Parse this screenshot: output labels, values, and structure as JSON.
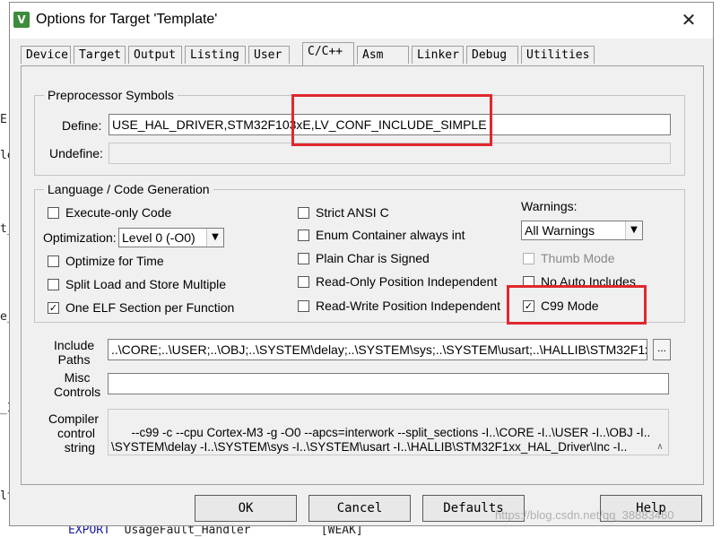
{
  "window": {
    "title": "Options for Target 'Template'",
    "app_icon_glyph": "V"
  },
  "tabs": [
    {
      "label": "Device"
    },
    {
      "label": "Target"
    },
    {
      "label": "Output"
    },
    {
      "label": "Listing"
    },
    {
      "label": "User"
    },
    {
      "label": "C/C++"
    },
    {
      "label": "Asm"
    },
    {
      "label": "Linker"
    },
    {
      "label": "Debug"
    },
    {
      "label": "Utilities"
    }
  ],
  "preprocessor": {
    "group_label": "Preprocessor Symbols",
    "define_label": "Define:",
    "define_value": "USE_HAL_DRIVER,STM32F103xE,LV_CONF_INCLUDE_SIMPLE",
    "undefine_label": "Undefine:",
    "undefine_value": ""
  },
  "language": {
    "group_label": "Language / Code Generation",
    "execute_only": {
      "label": "Execute-only Code",
      "checked": false
    },
    "optimization_label": "Optimization:",
    "optimization_value": "Level 0 (-O0)",
    "optimize_time": {
      "label": "Optimize for Time",
      "checked": false
    },
    "split_load": {
      "label": "Split Load and Store Multiple",
      "checked": false
    },
    "one_elf": {
      "label": "One ELF Section per Function",
      "checked": true
    },
    "strict_ansi": {
      "label": "Strict ANSI C",
      "checked": false
    },
    "enum_container": {
      "label": "Enum Container always int",
      "checked": false
    },
    "plain_char": {
      "label": "Plain Char is Signed",
      "checked": false
    },
    "ro_pi": {
      "label": "Read-Only Position Independent",
      "checked": false
    },
    "rw_pi": {
      "label": "Read-Write Position Independent",
      "checked": false
    },
    "warnings_label": "Warnings:",
    "warnings_value": "All Warnings",
    "thumb_mode": {
      "label": "Thumb Mode",
      "checked": false
    },
    "no_auto_includes": {
      "label": "No Auto Includes",
      "checked": false
    },
    "c99_mode": {
      "label": "C99 Mode",
      "checked": true
    }
  },
  "paths": {
    "include_label_1": "Include",
    "include_label_2": "Paths",
    "include_value": "..\\CORE;..\\USER;..\\OBJ;..\\SYSTEM\\delay;..\\SYSTEM\\sys;..\\SYSTEM\\usart;..\\HALLIB\\STM32F1x",
    "browse_label": "...",
    "misc_label_1": "Misc",
    "misc_label_2": "Controls",
    "misc_value": "",
    "compiler_label_1": "Compiler",
    "compiler_label_2": "control",
    "compiler_label_3": "string",
    "compiler_value": "--c99 -c --cpu Cortex-M3 -g -O0 --apcs=interwork --split_sections -I..\\CORE -I..\\USER -I..\\OBJ -I..\n\\SYSTEM\\delay -I..\\SYSTEM\\sys -I..\\SYSTEM\\usart -I..\\HALLIB\\STM32F1xx_HAL_Driver\\Inc -I.."
  },
  "buttons": {
    "ok": "OK",
    "cancel": "Cancel",
    "defaults": "Defaults",
    "help": "Help"
  },
  "background": {
    "bottom_keyword": "EXPORT",
    "bottom_symbol": "UsageFault_Handler",
    "bottom_attr": "[WEAK]",
    "left_fragments": [
      "E",
      "le",
      "t_",
      "e_",
      "_I",
      "lt"
    ]
  },
  "watermark": "https://blog.csdn.net/qq_38883460",
  "colors": {
    "highlight": "#e0282e",
    "dialog_bg": "#f0f0f0"
  }
}
